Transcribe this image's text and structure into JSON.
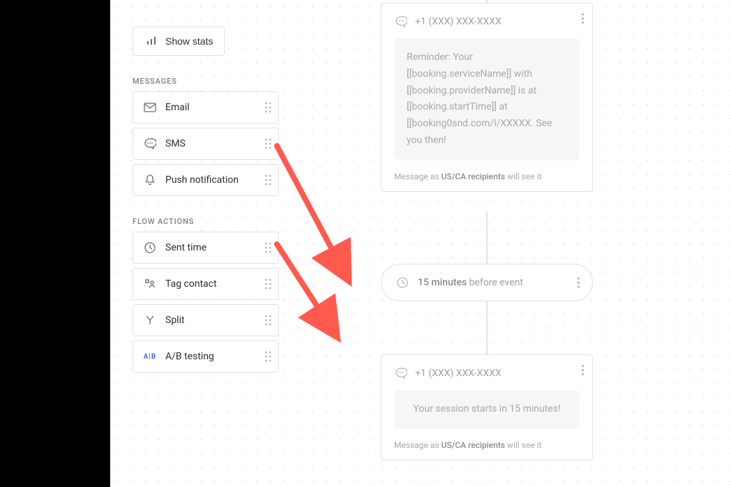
{
  "toolbar": {
    "show_stats_label": "Show stats"
  },
  "sections": {
    "messages_title": "MESSAGES",
    "flow_actions_title": "FLOW ACTIONS"
  },
  "messages": {
    "email": "Email",
    "sms": "SMS",
    "push": "Push notification"
  },
  "flow_actions": {
    "sent_time": "Sent time",
    "tag_contact": "Tag contact",
    "split": "Split",
    "ab_testing": "A/B testing"
  },
  "node1": {
    "phone": "+1 (XXX) XXX-XXXX",
    "body": "Reminder: Your [[booking.serviceName]] with [[booking.providerName]] is at [[booking.startTime]] at [[booking0snd.com/l/XXXXX. See you then!",
    "footer_prefix": "Message as ",
    "footer_bold": "US/CA recipients",
    "footer_suffix": " will see it"
  },
  "delay": {
    "bold": "15 minutes",
    "rest": " before event"
  },
  "node2": {
    "phone": "+1 (XXX) XXX-XXXX",
    "body": "Your session starts in 15 minutes!",
    "footer_prefix": "Message as ",
    "footer_bold": "US/CA recipients",
    "footer_suffix": " will see it"
  }
}
